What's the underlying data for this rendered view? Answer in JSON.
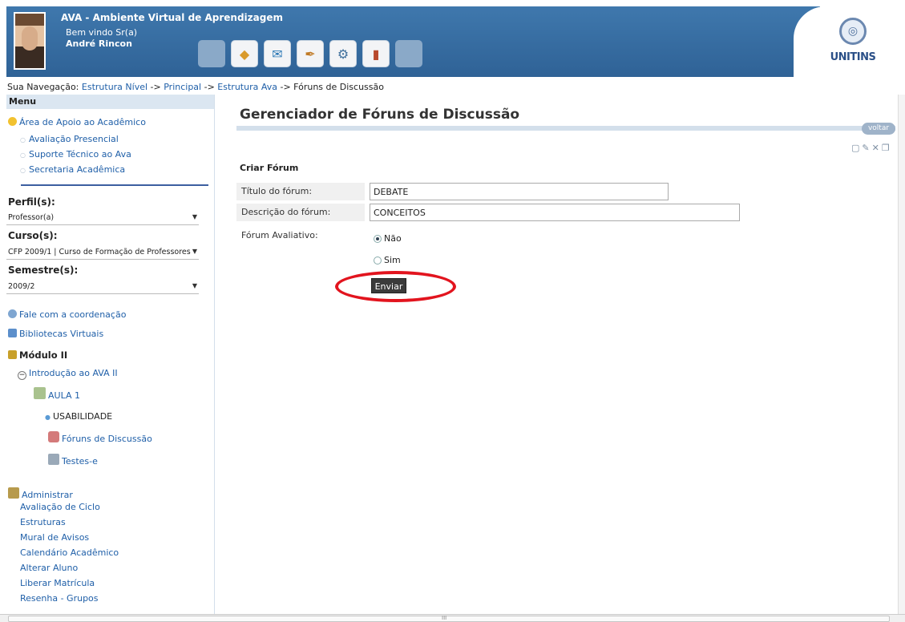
{
  "header": {
    "app_title": "AVA - Ambiente Virtual de Aprendizagem",
    "welcome": "Bem vindo Sr(a)",
    "user_name": "André Rincon",
    "logo_text": "UNITINS",
    "toolbar_icons": [
      "blank",
      "folder-icon",
      "mail-icon",
      "tools-icon",
      "settings-icon",
      "books-icon",
      "blank"
    ]
  },
  "breadcrumb": {
    "prefix": "Sua Navegação:",
    "items": [
      "Estrutura Nível",
      "Principal",
      "Estrutura Ava"
    ],
    "separator": "->",
    "current": "Fóruns de Discussão"
  },
  "sidebar": {
    "menu_label": "Menu",
    "support_title": "Área de Apoio ao Acadêmico",
    "support_items": [
      "Avaliação Presencial",
      "Suporte Técnico ao Ava",
      "Secretaria Acadêmica"
    ],
    "perfil_label": "Perfil(s):",
    "perfil_value": "Professor(a)",
    "curso_label": "Curso(s):",
    "curso_value": "CFP 2009/1 | Curso de Formação de Professores",
    "semestre_label": "Semestre(s):",
    "semestre_value": "2009/2",
    "fale": "Fale com a coordenação",
    "bibliotecas": "Bibliotecas Virtuais",
    "modulo": "Módulo II",
    "introducao": "Introdução ao AVA II",
    "aula": "AULA 1",
    "usabilidade": "USABILIDADE",
    "foruns": "Fóruns de Discussão",
    "testes": "Testes-e",
    "administrar": "Administrar",
    "admin_items": [
      "Avaliação de Ciclo",
      "Estruturas",
      "Mural de Avisos",
      "Calendário Acadêmico",
      "Alterar Aluno",
      "Liberar Matrícula",
      "Resenha - Grupos"
    ]
  },
  "main": {
    "title": "Gerenciador de Fóruns de Discussão",
    "voltar": "voltar",
    "form_title": "Criar Fórum",
    "titulo_label": "Título do fórum:",
    "titulo_value": "DEBATE",
    "descricao_label": "Descrição do fórum:",
    "descricao_value": "CONCEITOS",
    "avaliativo_label": "Fórum Avaliativo:",
    "option_nao": "Não",
    "option_sim": "Sim",
    "selected_option": "Não",
    "submit_label": "Enviar",
    "highlight_color": "#e2141e"
  },
  "scrollbar": {
    "middle_mark": "III"
  }
}
